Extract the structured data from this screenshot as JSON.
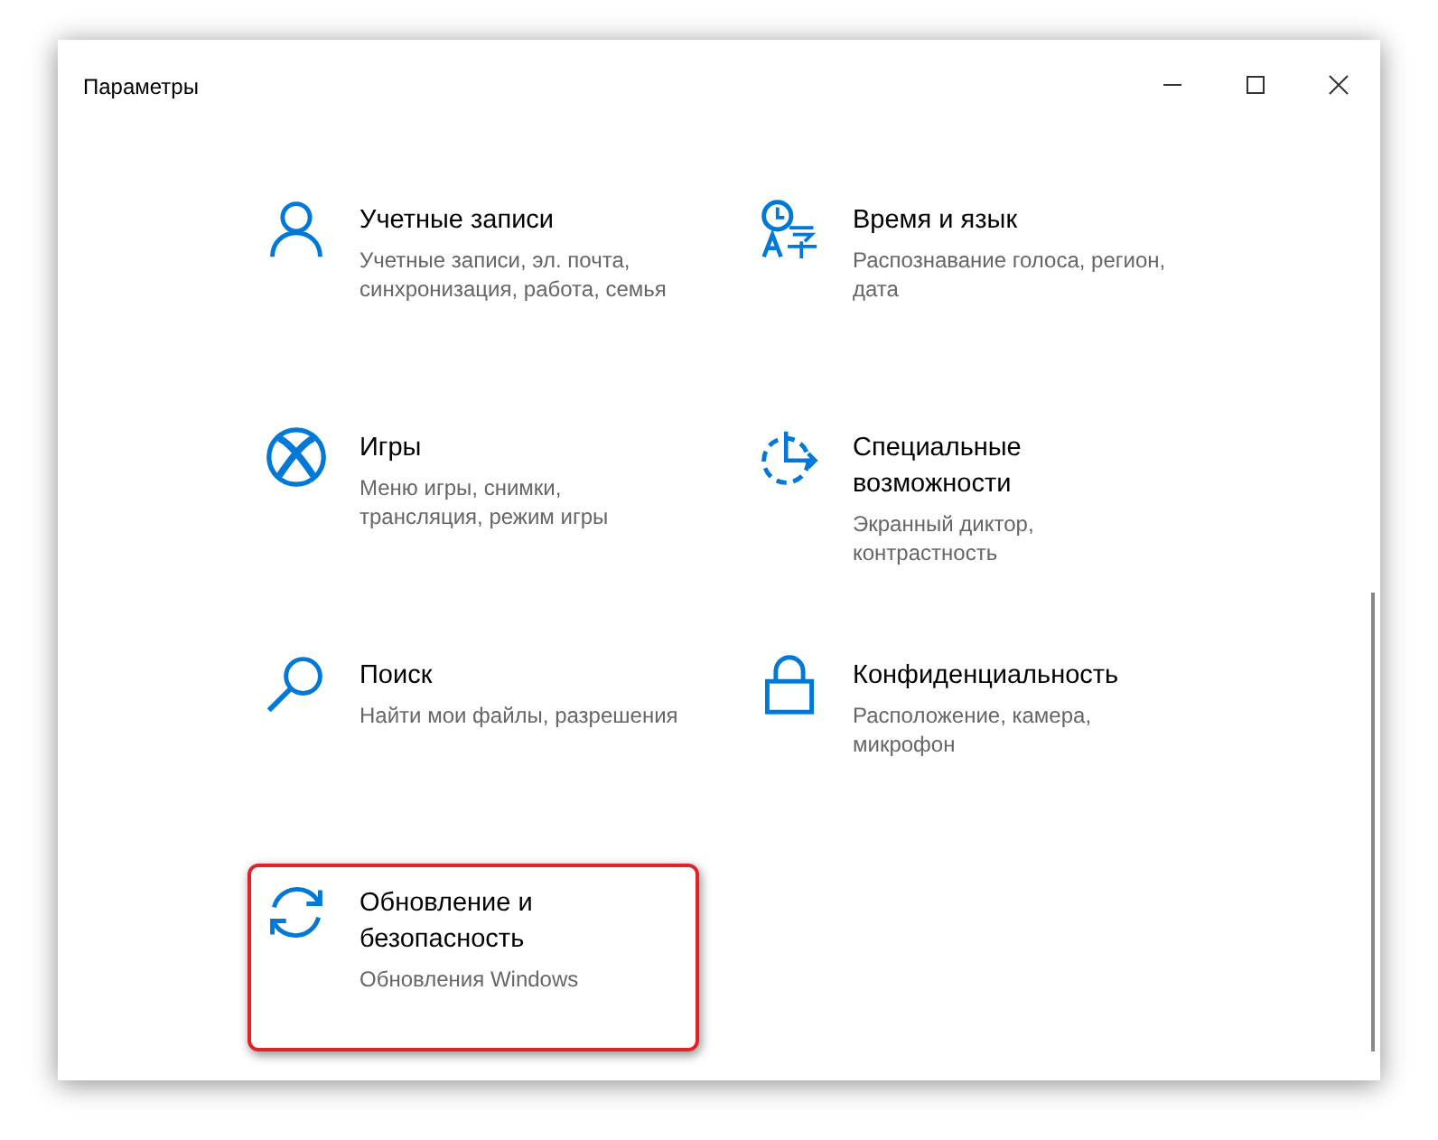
{
  "window": {
    "title": "Параметры"
  },
  "items": [
    {
      "kind": "person",
      "title": "Учетные записи",
      "description": "Учетные записи, эл. почта, синхронизация, работа, семья",
      "highlighted": false
    },
    {
      "kind": "time-language",
      "title": "Время и язык",
      "description": "Распознавание голоса, регион, дата",
      "highlighted": false
    },
    {
      "kind": "xbox",
      "title": "Игры",
      "description": "Меню игры, снимки, трансляция, режим игры",
      "highlighted": false
    },
    {
      "kind": "accessibility",
      "title": "Специальные возможности",
      "description": "Экранный диктор, контрастность",
      "highlighted": false
    },
    {
      "kind": "search",
      "title": "Поиск",
      "description": "Найти мои файлы, разрешения",
      "highlighted": false
    },
    {
      "kind": "lock",
      "title": "Конфиденциальность",
      "description": "Расположение, камера, микрофон",
      "highlighted": false
    },
    {
      "kind": "sync",
      "title": "Обновление и безопасность",
      "description": "Обновления Windows",
      "highlighted": true
    }
  ]
}
